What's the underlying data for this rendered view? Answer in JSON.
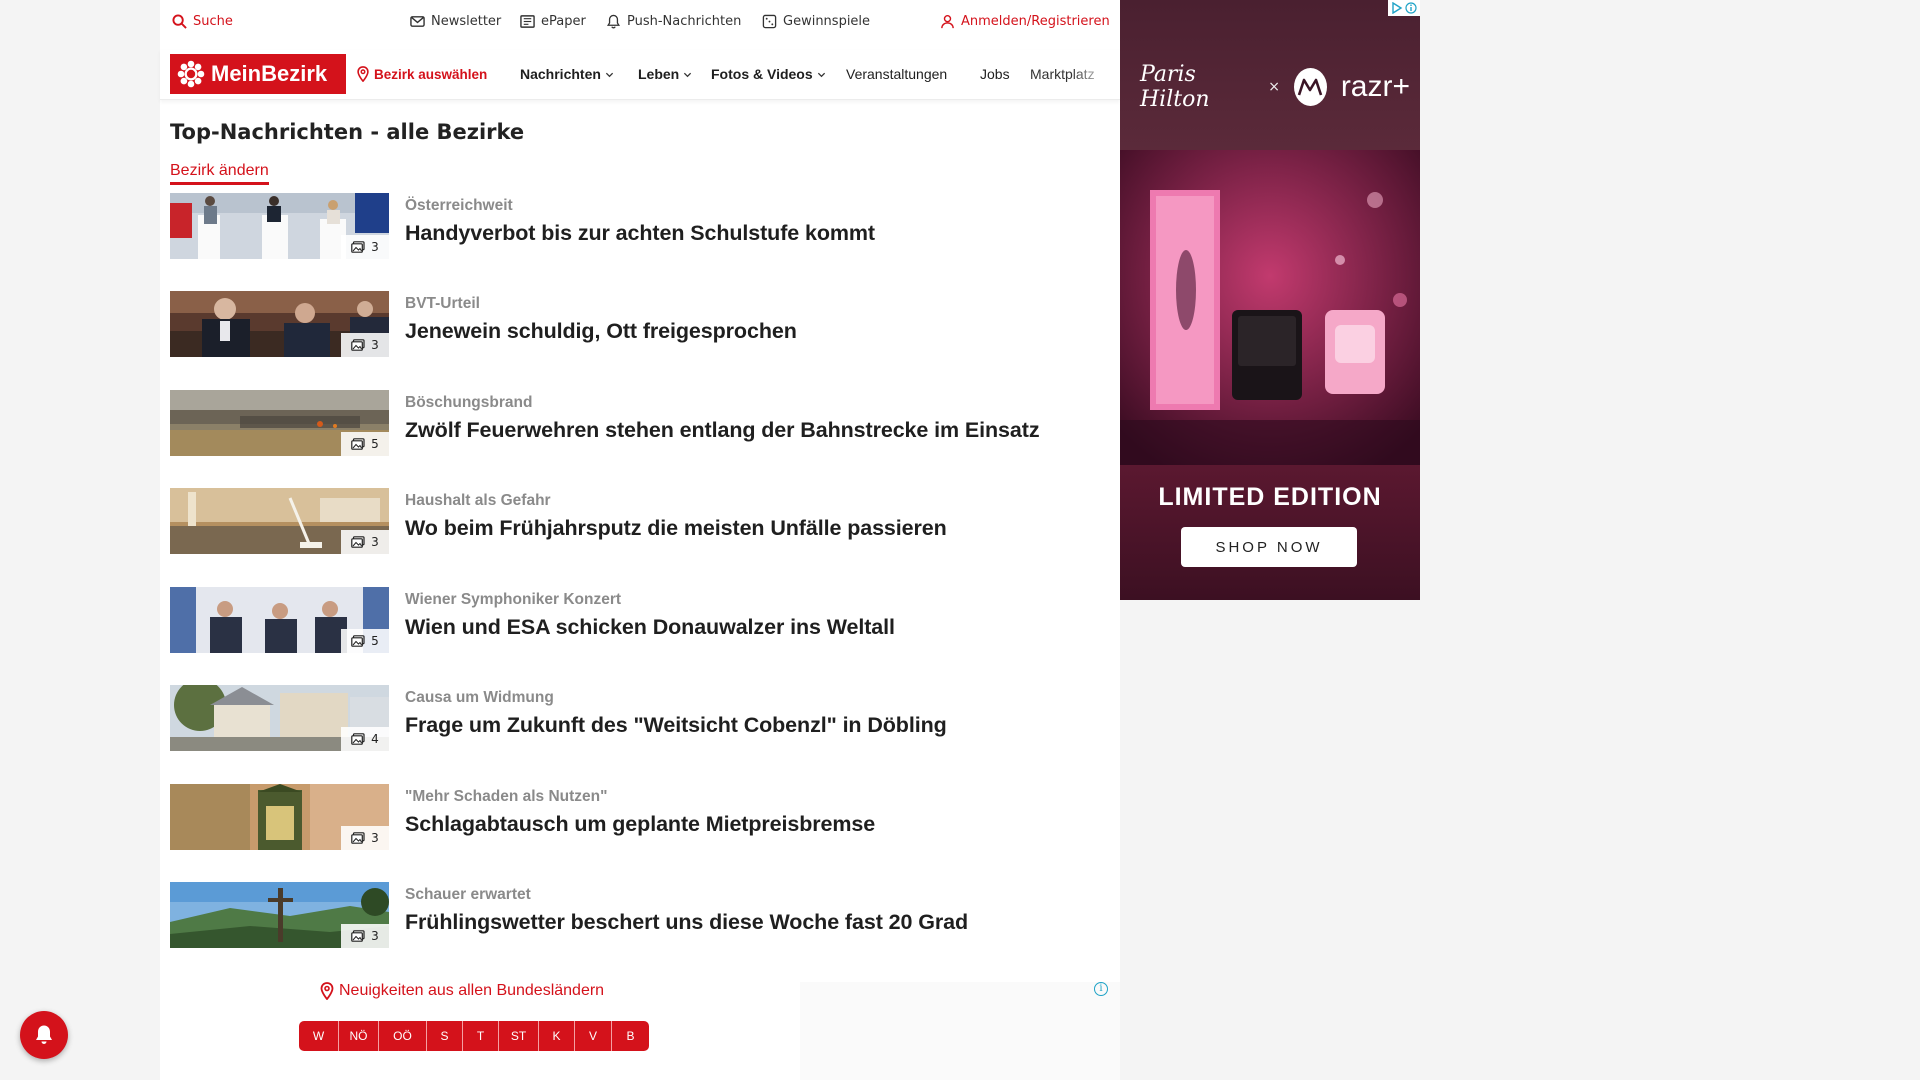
{
  "utility_bar": {
    "search": "Suche",
    "newsletter": "Newsletter",
    "epaper": "ePaper",
    "push": "Push-Nachrichten",
    "gewinnspiele": "Gewinnspiele",
    "login": "Anmelden/Registrieren"
  },
  "navbar": {
    "logo": "MeinBezirk",
    "bezirk": "Bezirk auswählen",
    "items": [
      "Nachrichten",
      "Leben",
      "Fotos & Videos",
      "Veranstaltungen",
      "Jobs",
      "Marktplatz"
    ]
  },
  "main": {
    "title": "Top-Nachrichten - alle Bezirke",
    "change_link": "Bezirk ändern",
    "articles": [
      {
        "kicker": "Österreichweit",
        "headline": "Handyverbot bis zur achten Schulstufe kommt",
        "photos": "3"
      },
      {
        "kicker": "BVT-Urteil",
        "headline": "Jenewein schuldig, Ott freigesprochen",
        "photos": "3"
      },
      {
        "kicker": "Böschungsbrand",
        "headline": "Zwölf Feuerwehren stehen entlang der Bahnstrecke im Einsatz",
        "photos": "5"
      },
      {
        "kicker": "Haushalt als Gefahr",
        "headline": "Wo beim Frühjahrsputz die meisten Unfälle passieren",
        "photos": "3"
      },
      {
        "kicker": "Wiener Symphoniker Konzert",
        "headline": "Wien und ESA schicken Donauwalzer ins Weltall",
        "photos": "5"
      },
      {
        "kicker": "Causa um Widmung",
        "headline": "Frage um Zukunft des \"Weitsicht Cobenzl\" in Döbling",
        "photos": "4"
      },
      {
        "kicker": "\"Mehr Schaden als Nutzen\"",
        "headline": "Schlagabtausch um geplante Mietpreisbremse",
        "photos": "3"
      },
      {
        "kicker": "Schauer erwartet",
        "headline": "Frühlingswetter beschert uns diese Woche fast 20 Grad",
        "photos": "3"
      }
    ]
  },
  "bundeslaender": {
    "title": "Neuigkeiten aus allen Bundesländern",
    "states": [
      "W",
      "NÖ",
      "OÖ",
      "S",
      "T",
      "ST",
      "K",
      "V",
      "B"
    ]
  },
  "ad": {
    "brand_signature": "Paris Hilton",
    "brand_x": "×",
    "brand_product": "razr+",
    "headline": "LIMITED EDITION",
    "cta": "SHOP NOW"
  },
  "colors": {
    "brand_red": "#d4121b",
    "kicker_gray": "#8a8a8a"
  }
}
